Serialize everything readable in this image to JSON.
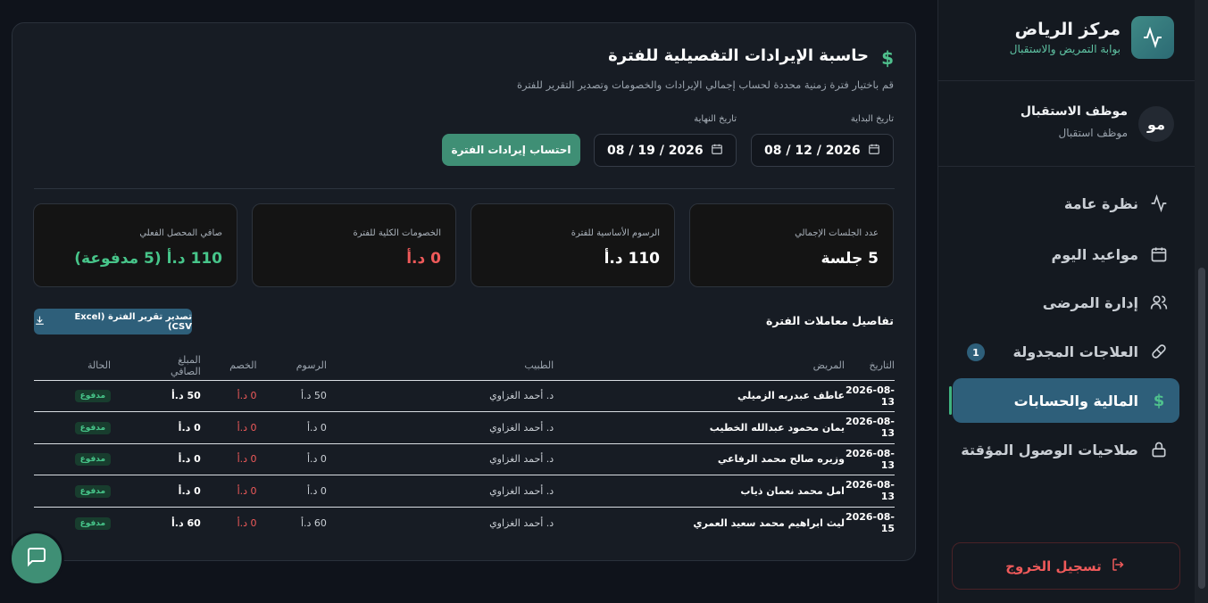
{
  "brand": {
    "title": "مركز الرياض",
    "subtitle": "بوابة التمريض والاستقبال",
    "logo_icon": "activity-icon"
  },
  "user": {
    "initials": "مو",
    "name": "موظف الاستقبال",
    "role": "موظف استقبال"
  },
  "nav": [
    {
      "label": "نظرة عامة",
      "icon": "activity-icon"
    },
    {
      "label": "مواعيد اليوم",
      "icon": "calendar-icon"
    },
    {
      "label": "إدارة المرضى",
      "icon": "users-icon"
    },
    {
      "label": "العلاجات المجدولة",
      "icon": "pill-icon",
      "badge": "1"
    },
    {
      "label": "المالية والحسابات",
      "icon": "dollar-icon",
      "active": true
    },
    {
      "label": "صلاحيات الوصول المؤقتة",
      "icon": "lock-icon"
    }
  ],
  "logout_label": "تسجيل الخروج",
  "calculator": {
    "title": "حاسبة الإيرادات التفصيلية للفترة",
    "subtitle": "قم باختيار فترة زمنية محددة لحساب إجمالي الإيرادات والخصومات وتصدير التقرير للفترة",
    "start_label": "تاريخ البداية",
    "start_value": "08 / 12 / 2026",
    "end_label": "تاريخ النهاية",
    "end_value": "08 / 19 / 2026",
    "calc_button": "احتساب إيرادات الفترة"
  },
  "stats": [
    {
      "label": "عدد الجلسات الإجمالي",
      "value": "5 جلسة",
      "color": "#ffffff"
    },
    {
      "label": "الرسوم الأساسية للفترة",
      "value": "110 د.أ",
      "color": "#ffffff"
    },
    {
      "label": "الخصومات الكلية للفترة",
      "value": "0 د.أ",
      "color": "#ef5a5a"
    },
    {
      "label": "صافي المحصل الفعلي",
      "value": "110 د.أ (5 مدفوعة)",
      "color": "#47c58a"
    }
  ],
  "transactions": {
    "title": "تفاصيل معاملات الفترة",
    "export_label": "تصدير تقرير الفترة (Excel (CSV",
    "columns": [
      "التاريخ",
      "المريض",
      "الطبيب",
      "الرسوم",
      "الخصم",
      "المبلغ الصافي",
      "الحالة"
    ],
    "rows": [
      [
        "2026-08-13",
        "عاطف عبدربه الزميلي",
        "د. أحمد الغزاوي",
        "50 د.أ",
        "0 د.أ",
        "50 د.أ",
        "مدفوع"
      ],
      [
        "2026-08-13",
        "يمان محمود عبدالله الخطيب",
        "د. أحمد الغزاوي",
        "0 د.أ",
        "0 د.أ",
        "0 د.أ",
        "مدفوع"
      ],
      [
        "2026-08-13",
        "وزيره صالح محمد الرفاعي",
        "د. أحمد الغزاوي",
        "0 د.أ",
        "0 د.أ",
        "0 د.أ",
        "مدفوع"
      ],
      [
        "2026-08-13",
        "امل محمد نعمان ذياب",
        "د. أحمد الغزاوي",
        "0 د.أ",
        "0 د.أ",
        "0 د.أ",
        "مدفوع"
      ],
      [
        "2026-08-15",
        "ليث ابراهيم محمد سعيد العمري",
        "د. أحمد الغزاوي",
        "60 د.أ",
        "0 د.أ",
        "60 د.أ",
        "مدفوع"
      ]
    ]
  },
  "chat_icon": "message-square-icon"
}
